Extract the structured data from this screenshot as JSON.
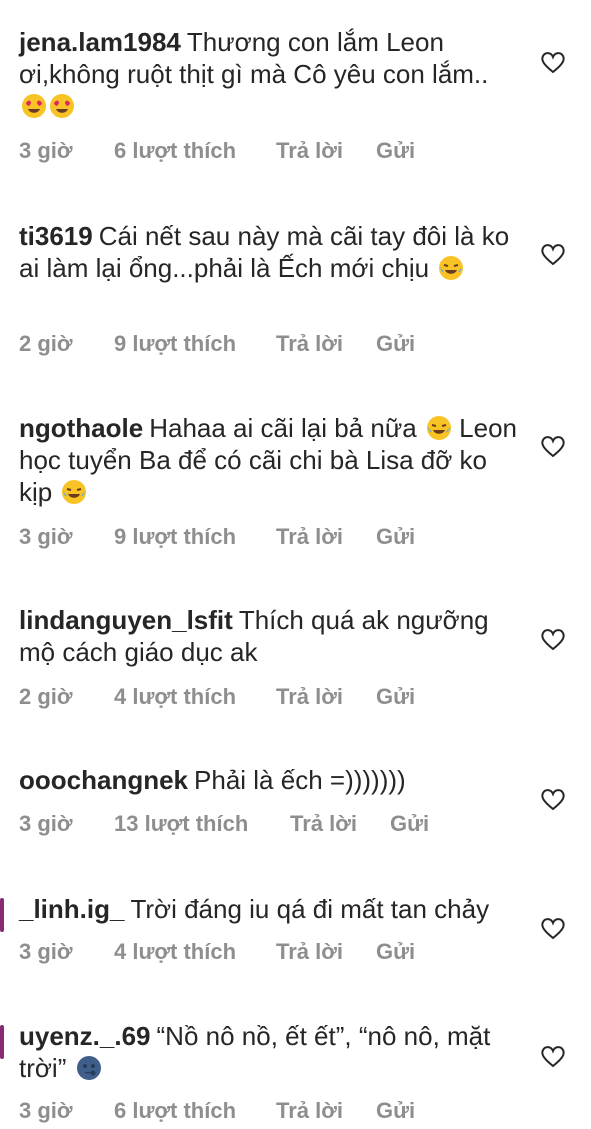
{
  "comments": [
    {
      "username": "jena.lam1984",
      "text": "Thương con lắm Leon ơi,không ruột thịt gì mà Cô yêu con lắm..",
      "emojis": [
        "heart-eyes-emoji",
        "heart-eyes-emoji"
      ],
      "time": "3 giờ",
      "likes": "6 lượt thích",
      "reply": "Trả lời",
      "send": "Gửi"
    },
    {
      "username": "ti3619",
      "text": "Cái nết sau này mà cãi tay đôi là ko ai làm lại ổng...phải là Ếch mới chịu",
      "emojis": [
        "tears-of-joy-emoji"
      ],
      "time": "2 giờ",
      "likes": "9 lượt thích",
      "reply": "Trả lời",
      "send": "Gửi"
    },
    {
      "username": "ngothaole",
      "text_a": "Hahaa ai cãi lại bả nữa",
      "text_b": "Leon học tuyển Ba để có cãi chi bà Lisa đỡ ko kịp",
      "emojis": [
        "tears-of-joy-emoji",
        "tears-of-joy-emoji"
      ],
      "time": "3 giờ",
      "likes": "9 lượt thích",
      "reply": "Trả lời",
      "send": "Gửi"
    },
    {
      "username": "lindanguyen_lsfit",
      "text": "Thích quá ak ngưỡng mộ cách giáo dục ak",
      "time": "2 giờ",
      "likes": "4 lượt thích",
      "reply": "Trả lời",
      "send": "Gửi"
    },
    {
      "username": "ooochangnek",
      "text": "Phải là ếch =)))))))",
      "time": "3 giờ",
      "likes": "13 lượt thích",
      "reply": "Trả lời",
      "send": "Gửi"
    },
    {
      "username": "_linh.ig_",
      "text": "Trời đáng iu qá đi mất tan chảy",
      "time": "3 giờ",
      "likes": "4 lượt thích",
      "reply": "Trả lời",
      "send": "Gửi"
    },
    {
      "username": "uyenz._.69",
      "text": "“Nồ nô nồ, ết ết”, “nô nô, mặt trời”",
      "emojis": [
        "moon-face-emoji"
      ],
      "time": "3 giờ",
      "likes": "6 lượt thích",
      "reply": "Trả lời",
      "send": "Gửi"
    }
  ],
  "colors": {
    "text": "#262626",
    "meta": "#8e8e8e",
    "heart_outline": "#262626"
  },
  "icons": {
    "like": "heart-outline-icon"
  }
}
